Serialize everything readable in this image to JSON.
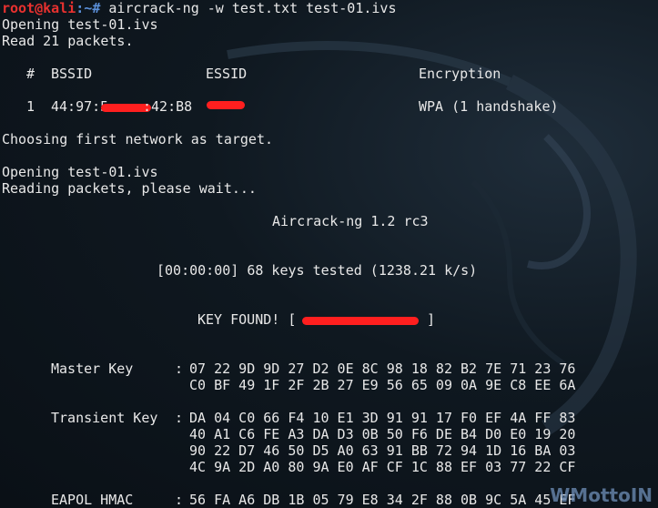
{
  "prompt": {
    "user": "root@kali",
    "path": ":~# ",
    "command": "aircrack-ng -w test.txt test-01.ivs"
  },
  "lines": {
    "l1": "Opening test-01.ivs",
    "l2": "Read 21 packets.",
    "hdr_num": "#",
    "hdr_bssid": "BSSID",
    "hdr_essid": "ESSID",
    "hdr_enc": "Encryption",
    "row_num": "1",
    "row_bssid_a": "44:97:5",
    "row_bssid_b": ":42:B8",
    "row_essid": "",
    "row_enc": "WPA (1 handshake)",
    "choose": "Choosing first network as target.",
    "open2": "Opening test-01.ivs",
    "reading": "Reading packets, please wait...",
    "version": "Aircrack-ng 1.2 rc3",
    "keys_tested": "[00:00:00] 68 keys tested (1238.21 k/s)",
    "key_found_pre": "KEY FOUND! [",
    "key_found_post": "]"
  },
  "master_key": {
    "label": "Master Key",
    "row1": "07 22 9D 9D 27 D2 0E 8C 98 18 82 B2 7E 71 23 76",
    "row2": "C0 BF 49 1F 2F 2B 27 E9 56 65 09 0A 9E C8 EE 6A"
  },
  "transient_key": {
    "label": "Transient Key",
    "row1": "DA 04 C0 66 F4 10 E1 3D 91 91 17 F0 EF 4A FF 83",
    "row2": "40 A1 C6 FE A3 DA D3 0B 50 F6 DE B4 D0 E0 19 20",
    "row3": "90 22 D7 46 50 D5 A0 63 91 BB 72 94 1D 16 BA 03",
    "row4": "4C 9A 2D A0 80 9A E0 AF CF 1C 88 EF 03 77 22 CF"
  },
  "eapol": {
    "label": "EAPOL HMAC",
    "row1": "56 FA A6 DB 1B 05 79 E8 34 2F 88 0B 9C 5A 45 EF"
  },
  "watermark": "WMottoIN",
  "colors": {
    "prompt_user": "#e8312f",
    "prompt_path": "#5a8fd8",
    "text": "#e8e8e8",
    "redaction": "#ff1f1f"
  }
}
